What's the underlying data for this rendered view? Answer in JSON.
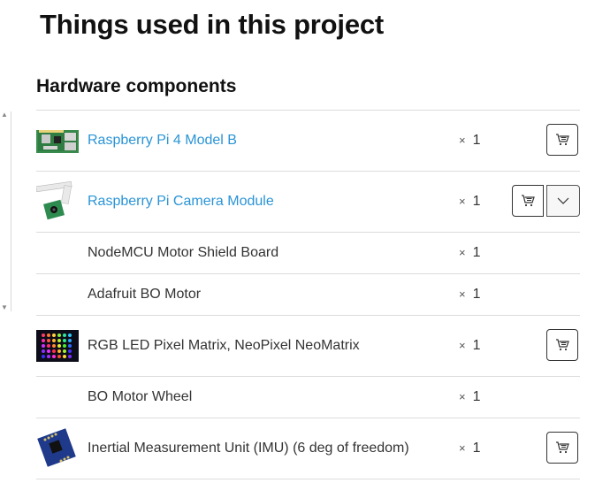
{
  "page": {
    "title": "Things used in this project"
  },
  "section": {
    "heading": "Hardware components"
  },
  "items": [
    {
      "name": "Raspberry Pi 4 Model B",
      "is_link": true,
      "quantity_symbol": "×",
      "quantity": "1",
      "has_thumbnail": true,
      "thumbnail": "raspberry-pi-board-image",
      "buttons": [
        "cart"
      ]
    },
    {
      "name": "Raspberry Pi Camera Module",
      "is_link": true,
      "quantity_symbol": "×",
      "quantity": "1",
      "has_thumbnail": true,
      "thumbnail": "camera-module-image",
      "buttons": [
        "cart",
        "expand"
      ]
    },
    {
      "name": "NodeMCU Motor Shield Board",
      "is_link": false,
      "quantity_symbol": "×",
      "quantity": "1",
      "has_thumbnail": false,
      "buttons": []
    },
    {
      "name": "Adafruit BO Motor",
      "is_link": false,
      "quantity_symbol": "×",
      "quantity": "1",
      "has_thumbnail": false,
      "buttons": []
    },
    {
      "name": "RGB LED Pixel Matrix, NeoPixel NeoMatrix",
      "is_link": false,
      "quantity_symbol": "×",
      "quantity": "1",
      "has_thumbnail": true,
      "thumbnail": "led-matrix-image",
      "buttons": [
        "cart"
      ]
    },
    {
      "name": "BO Motor Wheel",
      "is_link": false,
      "quantity_symbol": "×",
      "quantity": "1",
      "has_thumbnail": false,
      "buttons": []
    },
    {
      "name": "Inertial Measurement Unit (IMU) (6 deg of freedom)",
      "is_link": false,
      "quantity_symbol": "×",
      "quantity": "1",
      "has_thumbnail": true,
      "thumbnail": "imu-board-image",
      "buttons": [
        "cart"
      ]
    }
  ],
  "icons": {
    "cart": "shopping-cart-icon",
    "expand": "chevron-down-icon",
    "scroll_up": "scroll-up-arrow-icon",
    "scroll_down": "scroll-down-arrow-icon"
  },
  "colors": {
    "link": "#2a94d6",
    "text": "#333333",
    "heading": "#111111",
    "divider": "#dcdcdc"
  }
}
